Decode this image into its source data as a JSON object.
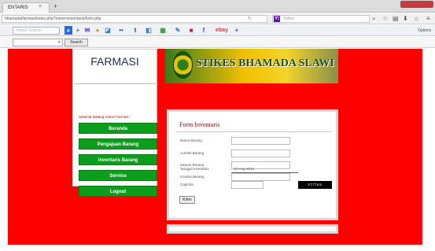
{
  "browser": {
    "tab_title": "ENTARIS",
    "tab_close": "×",
    "new_tab": "+",
    "url": "bhamada/farmasi/index.php?name=inventaris/form.php",
    "search_placeholder": "Yahoo",
    "yahoo_logo": "Y!",
    "toolbar_search_placeholder": "Yahoo! Search",
    "toolbar_search_button": "Search",
    "options_label": "Options",
    "search_button": "Search"
  },
  "sidebar": {
    "title": "FARMASI",
    "welcome": "Selamat Datang Admin Farmasi :",
    "items": [
      {
        "label": "Beranda"
      },
      {
        "label": "Pengajuan Barang"
      },
      {
        "label": "Inventaris Barang"
      },
      {
        "label": "Service"
      },
      {
        "label": "Logout"
      }
    ]
  },
  "banner": {
    "title": "STIKES BHAMADA SLAWI"
  },
  "form": {
    "title": "Form Inventaris",
    "fields": {
      "nama_barang": {
        "label": "Nama Barang",
        "value": ""
      },
      "jumlah_barang": {
        "label": "Jumlah Barang",
        "value": ""
      },
      "satuan_barang": {
        "label": "Satuan Barang",
        "value": ""
      },
      "kondisi_barang": {
        "label": "Kondisi Barang",
        "value": ""
      },
      "tanggal_inventaris": {
        "label": "Tanggal Inventaris",
        "value": "23-Aug-2014"
      },
      "captcha": {
        "label": "Captcha",
        "value": "",
        "image_text": "37ffa5"
      }
    },
    "colon": ":",
    "submit_label": "Kirim"
  },
  "colors": {
    "page_bg": "#fe0000",
    "nav_green": "#0b9e1b",
    "title_navy": "#223049",
    "form_title": "#8b0000"
  }
}
